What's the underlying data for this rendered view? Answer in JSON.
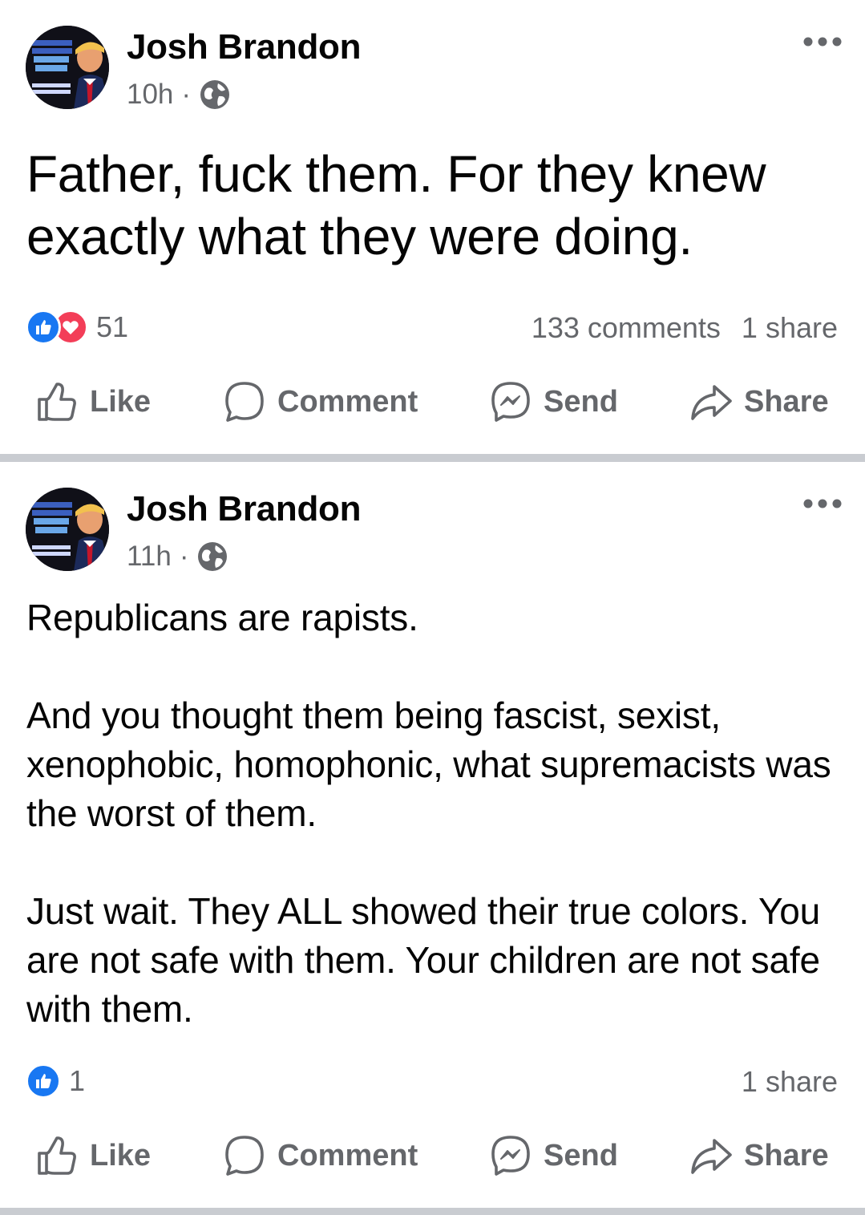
{
  "posts": [
    {
      "author": "Josh Brandon",
      "time": "10h",
      "text": "Father, fuck them.  For they knew exactly what they were doing.",
      "reaction_count": "51",
      "reactions": [
        "like-icon",
        "love-icon"
      ],
      "comments": "133 comments",
      "shares": "1 share"
    },
    {
      "author": "Josh Brandon",
      "time": "11h",
      "paragraphs": [
        "Republicans are rapists.",
        "And you thought them being fascist, sexist, xenophobic, homophonic, what supremacists was the worst of them.",
        "Just wait.   They ALL showed their true colors. You are not safe with them.  Your children are not safe with them."
      ],
      "reaction_count": "1",
      "reactions": [
        "like-icon"
      ],
      "shares": "1 share"
    }
  ],
  "actions": {
    "like": "Like",
    "comment": "Comment",
    "send": "Send",
    "share": "Share"
  },
  "separator_dot": "·",
  "colors": {
    "text": "#050505",
    "secondary": "#65676b",
    "like_blue": "#1877f2",
    "love_red": "#f33e58",
    "divider": "#c9ccd1"
  }
}
